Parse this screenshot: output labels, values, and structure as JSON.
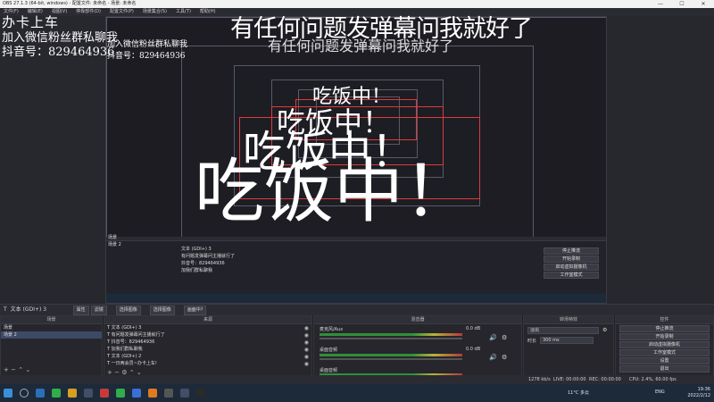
{
  "window": {
    "title": "OBS 27.1.3 (64-bit, windows) - 配置文件: 未命名 - 场景: 未命名",
    "controls": [
      "—",
      "☐",
      "✕"
    ]
  },
  "menu": [
    "文件(F)",
    "编辑(E)",
    "视图(V)",
    "停靠部件(D)",
    "配置文件(P)",
    "场景集合(S)",
    "工具(T)",
    "帮助(H)"
  ],
  "overlay": {
    "line1": "办卡上车",
    "line2": "加入微信粉丝群私聊我",
    "line3": "抖音号：829464936",
    "banner": "有任何问题发弹幕问我就好了",
    "big": "吃饭中！"
  },
  "source_toolbar": {
    "selected_source": "文本 (GDI+) 3",
    "properties": "属性",
    "filters": "滤镜",
    "select_image": "选择图像",
    "image_label": "选择图像",
    "preview_label": "画面中?"
  },
  "scenes": {
    "header": "场景",
    "items": [
      "场景",
      "场景 2"
    ]
  },
  "sources": {
    "header": "来源",
    "items": [
      "文本 (GDI+) 3",
      "有问题发弹幕问主播就行了",
      "抖音号：829464936",
      "加我们群私聊我",
      "文本 (GDI+) 2",
      "一日两会员~办卡上车!"
    ]
  },
  "mixer": {
    "header": "混音器",
    "channels": [
      {
        "name": "麦克风/Aux",
        "db": "0.0 dB"
      },
      {
        "name": "桌面音频",
        "db": "0.0 dB"
      },
      {
        "name": "桌面音频",
        "db": "0.0 dB"
      }
    ]
  },
  "transitions": {
    "header": "转场特效",
    "type": "淡出",
    "duration_label": "时长",
    "duration": "300 ms"
  },
  "controls": {
    "header": "控件",
    "buttons": [
      "停止推流",
      "开始录制",
      "启动虚拟摄像机",
      "工作室模式",
      "设置",
      "退出"
    ]
  },
  "status": {
    "live": "LIVE: 00:00:00",
    "rec": "REC: 00:00:00",
    "cpu": "CPU: 2.4%, 60.00 fps",
    "kbps": "1278 kb/s",
    "dropped": "00:00:00"
  },
  "taskbar": {
    "weather": "11°C 多云",
    "lang": "ENG",
    "time": "19:36",
    "date": "2022/2/12"
  },
  "colors": {
    "accent_red": "#e03a3a",
    "selection": "#3c4a66",
    "meter_green": "#2f8f3a"
  }
}
